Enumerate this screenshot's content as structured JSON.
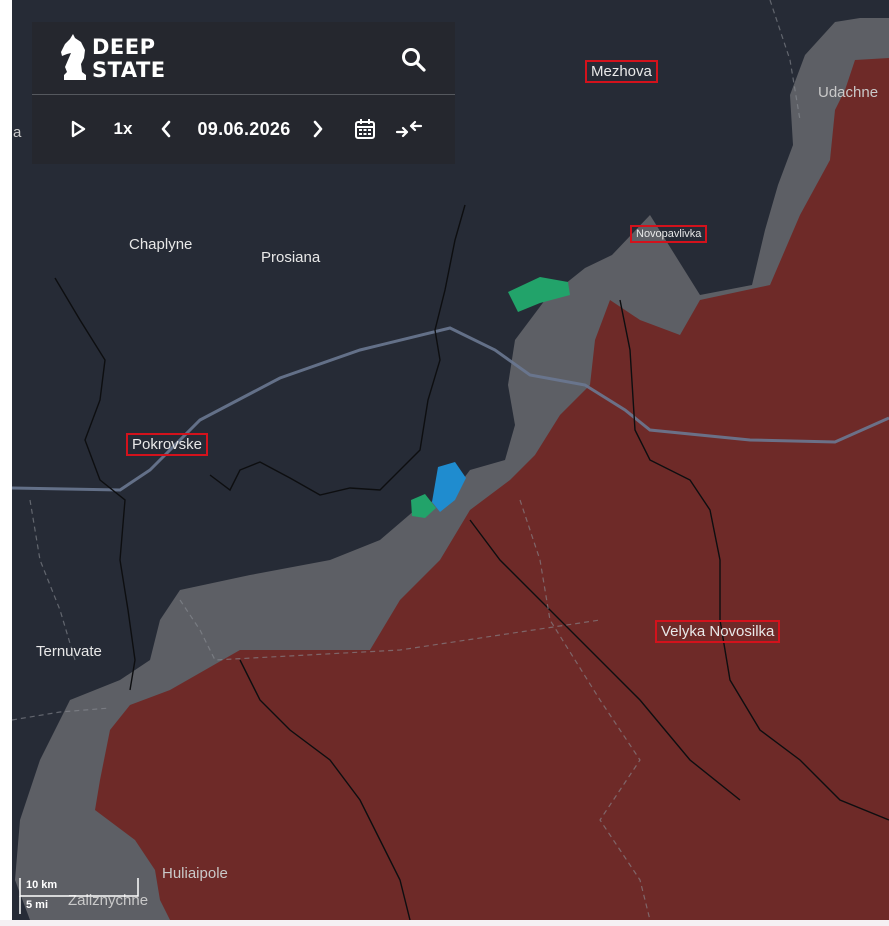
{
  "app": {
    "brand_line1": "DEEP",
    "brand_line2": "STATE"
  },
  "toolbar": {
    "speed": "1x",
    "date": "09.06.2026"
  },
  "icons": {
    "logo": "knight-icon",
    "search": "search-icon",
    "play": "play-icon",
    "prev": "chevron-left-icon",
    "next": "chevron-right-icon",
    "calendar": "calendar-icon",
    "compare": "compare-arrows-icon"
  },
  "places": {
    "mezhova": "Mezhova",
    "udachne": "Udachne",
    "chaplyne": "Chaplyne",
    "prosiana": "Prosiana",
    "novopavlivka": "Novopavlivka",
    "pokrovske": "Pokrovske",
    "ternuvate": "Ternuvate",
    "velyka_novosilka": "Velyka Novosilka",
    "huliaipole": "Huliaipole",
    "zaliznychne": "Zaliznychne",
    "edge_fragment": "a"
  },
  "scale_bar": {
    "metric": "10 km",
    "imperial": "5 mi"
  },
  "colors": {
    "land": "#262b36",
    "occupied": "#6e2a28",
    "contested": "#5d5f65",
    "liberated_green": "#22a36a",
    "liberated_blue": "#1f8ccf",
    "highlight_box": "#d3121c"
  }
}
